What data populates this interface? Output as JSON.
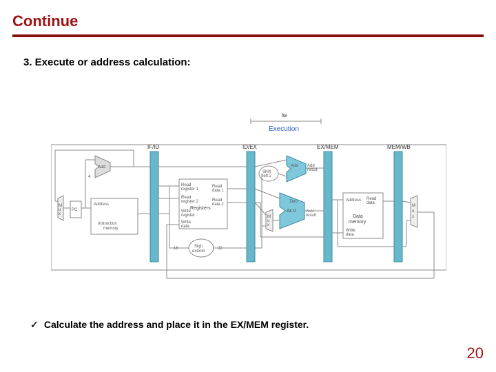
{
  "title": "Continue",
  "heading": "3.  Execute or address calculation:",
  "bullet": "Calculate the address and place it in the EX/MEM register.",
  "page_num": "20",
  "pipeline": {
    "lw": "lw",
    "phase": "Execution",
    "stage_if_id": "IF/ID",
    "stage_id_ex": "ID/EX",
    "stage_ex_mem": "EX/MEM",
    "stage_mem_wb": "MEM/WB",
    "add": "Add",
    "four": "4",
    "pc": "PC",
    "addr": "Address",
    "imem": "Instruction\nmemory",
    "regs": "Registers",
    "rr1": "Read\nregister 1",
    "rr2": "Read\nregister 2",
    "wr": "Write\nregister",
    "wd": "Write\ndata",
    "rdata1": "Read\ndata 1",
    "rdata2": "Read\ndata 2",
    "signext": "Sign\nextend",
    "in16": "16",
    "out32": "32",
    "shift": "Shift\nleft 2",
    "add2": "Add",
    "add_res": "Add\nresult",
    "zero": "Zero",
    "alu": "ALU",
    "alu_res": "ALU\nresult",
    "dmem": "Data\nmemory",
    "dmem_addr": "Address",
    "dmem_rd": "Read\ndata",
    "dmem_wd": "Write\ndata",
    "mux": "M\nu\nx"
  }
}
